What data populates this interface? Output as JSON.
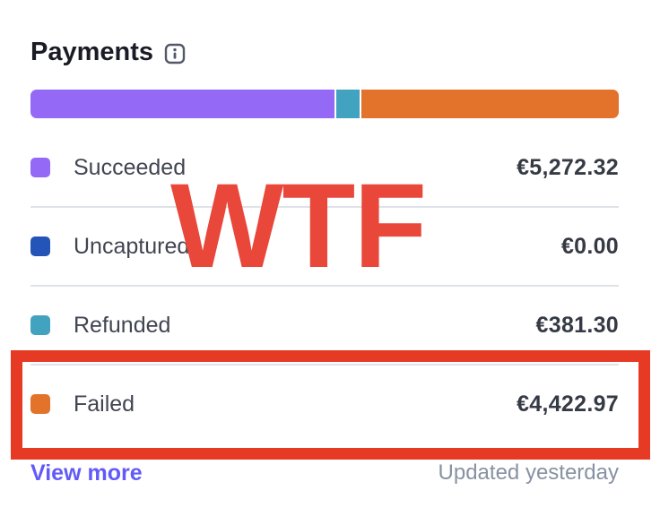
{
  "header": {
    "title": "Payments",
    "info_icon": "info-icon"
  },
  "breakdown_bar": {
    "segments": [
      {
        "name": "Succeeded",
        "color": "#9369f6",
        "share": 0.52
      },
      {
        "name": "Refunded",
        "color": "#41a3bf",
        "share": 0.04
      },
      {
        "name": "Failed",
        "color": "#e3722b",
        "share": 0.44
      }
    ]
  },
  "rows": [
    {
      "label": "Succeeded",
      "amount": "€5,272.32",
      "color": "#9369f6"
    },
    {
      "label": "Uncaptured",
      "amount": "€0.00",
      "color": "#2554b8"
    },
    {
      "label": "Refunded",
      "amount": "€381.30",
      "color": "#41a3bf"
    },
    {
      "label": "Failed",
      "amount": "€4,422.97",
      "color": "#e3722b"
    }
  ],
  "footer": {
    "view_more_label": "View more",
    "updated_label": "Updated yesterday"
  },
  "annotation": {
    "overlay_text": "WTF",
    "overlay_color": "#e8473a",
    "highlight_color": "#e63a25"
  }
}
